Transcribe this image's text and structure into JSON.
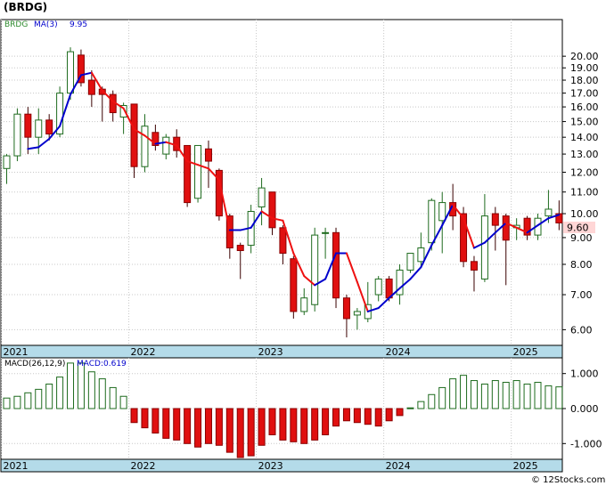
{
  "title": "(BRDG)",
  "footer": "© 12Stocks.com",
  "chart_data": [
    {
      "type": "candlestick",
      "ticker": "BRDG",
      "legend": {
        "ticker_label": "BRDG",
        "ma_label": "MA(3)",
        "ma_value": "9.95"
      },
      "last_price": "9.60",
      "y_scale": "log",
      "ylim": [
        5.6,
        23.5
      ],
      "y_ticks": [
        "20.00",
        "19.00",
        "18.00",
        "17.00",
        "16.00",
        "15.00",
        "14.00",
        "13.00",
        "12.00",
        "11.00",
        "10.00",
        "9.00",
        "8.00",
        "7.00",
        "6.00"
      ],
      "x_labels": [
        {
          "label": "2021",
          "month": 0
        },
        {
          "label": "2022",
          "month": 12
        },
        {
          "label": "2023",
          "month": 24
        },
        {
          "label": "2024",
          "month": 36
        },
        {
          "label": "2025",
          "month": 48
        }
      ],
      "candles": [
        [
          12.2,
          12.9,
          11.4,
          13.0
        ],
        [
          12.9,
          15.5,
          12.6,
          15.9
        ],
        [
          15.5,
          14.0,
          13.0,
          16.0
        ],
        [
          14.0,
          15.1,
          13.0,
          15.9
        ],
        [
          15.1,
          14.2,
          13.8,
          15.5
        ],
        [
          14.2,
          17.0,
          14.0,
          17.5
        ],
        [
          17.0,
          20.4,
          16.5,
          20.8
        ],
        [
          20.1,
          17.8,
          17.5,
          20.6
        ],
        [
          18.0,
          16.9,
          16.0,
          18.8
        ],
        [
          17.3,
          16.9,
          15.0,
          17.5
        ],
        [
          16.9,
          15.6,
          15.0,
          17.2
        ],
        [
          15.3,
          16.1,
          14.2,
          16.3
        ],
        [
          16.2,
          12.3,
          11.7,
          16.2
        ],
        [
          12.3,
          14.7,
          12.0,
          15.5
        ],
        [
          14.3,
          13.5,
          13.2,
          14.8
        ],
        [
          13.0,
          14.0,
          12.7,
          14.2
        ],
        [
          14.0,
          13.2,
          12.8,
          14.5
        ],
        [
          13.5,
          10.5,
          10.3,
          13.5
        ],
        [
          10.7,
          13.5,
          10.5,
          13.5
        ],
        [
          13.3,
          12.6,
          11.2,
          13.8
        ],
        [
          12.1,
          9.9,
          9.7,
          12.2
        ],
        [
          9.9,
          8.6,
          8.2,
          10.0
        ],
        [
          8.7,
          8.5,
          7.5,
          8.8
        ],
        [
          8.7,
          10.1,
          8.4,
          10.4
        ],
        [
          10.3,
          11.2,
          9.5,
          11.7
        ],
        [
          11.0,
          9.4,
          9.1,
          11.0
        ],
        [
          9.4,
          8.4,
          8.0,
          9.5
        ],
        [
          8.2,
          6.5,
          6.3,
          8.3
        ],
        [
          6.5,
          6.9,
          6.4,
          7.2
        ],
        [
          6.7,
          9.1,
          6.5,
          9.4
        ],
        [
          9.2,
          9.2,
          8.2,
          9.4
        ],
        [
          9.2,
          6.9,
          6.6,
          9.4
        ],
        [
          6.9,
          6.3,
          5.8,
          7.0
        ],
        [
          6.4,
          6.5,
          6.0,
          6.6
        ],
        [
          6.3,
          6.7,
          6.2,
          7.4
        ],
        [
          7.0,
          7.5,
          6.8,
          7.6
        ],
        [
          7.5,
          6.9,
          6.8,
          7.6
        ],
        [
          7.0,
          7.8,
          6.7,
          8.0
        ],
        [
          7.8,
          8.4,
          7.7,
          8.4
        ],
        [
          8.1,
          8.6,
          7.9,
          9.2
        ],
        [
          8.8,
          10.6,
          8.5,
          10.7
        ],
        [
          9.7,
          10.5,
          8.4,
          11.0
        ],
        [
          10.5,
          9.9,
          9.3,
          11.4
        ],
        [
          10.0,
          8.1,
          7.9,
          10.3
        ],
        [
          8.1,
          7.8,
          7.1,
          8.3
        ],
        [
          7.5,
          9.9,
          7.4,
          10.9
        ],
        [
          10.0,
          9.5,
          8.5,
          10.3
        ],
        [
          9.9,
          8.9,
          7.3,
          10.0
        ],
        [
          9.4,
          9.5,
          8.9,
          9.8
        ],
        [
          9.8,
          9.1,
          8.9,
          9.9
        ],
        [
          9.1,
          9.8,
          8.9,
          10.0
        ],
        [
          9.9,
          10.2,
          9.6,
          11.1
        ],
        [
          10.0,
          9.6,
          9.3,
          10.6
        ]
      ],
      "ma_series_name": "MA(3)",
      "ma": [
        null,
        null,
        13.3,
        13.4,
        13.9,
        14.7,
        16.9,
        18.4,
        18.6,
        17.2,
        16.4,
        15.9,
        14.5,
        14.1,
        13.6,
        13.7,
        13.5,
        12.6,
        12.4,
        12.2,
        11.6,
        9.3,
        9.3,
        9.4,
        10.1,
        9.8,
        9.7,
        8.4,
        7.6,
        7.3,
        7.5,
        8.4,
        8.4,
        7.4,
        6.5,
        6.6,
        6.9,
        7.2,
        7.5,
        7.9,
        8.7,
        9.5,
        10.4,
        9.8,
        8.6,
        8.8,
        9.2,
        9.6,
        9.4,
        9.2,
        9.5,
        9.8,
        9.95
      ]
    },
    {
      "type": "bar",
      "series_label": "MACD(26,12,9)",
      "value_label": "MACD:0.619",
      "ylim": [
        -1.45,
        1.45
      ],
      "y_ticks": [
        "1.000",
        "0.000",
        "-1.000"
      ],
      "x_labels": [
        {
          "label": "2021",
          "month": 0
        },
        {
          "label": "2022",
          "month": 12
        },
        {
          "label": "2023",
          "month": 24
        },
        {
          "label": "2024",
          "month": 36
        },
        {
          "label": "2025",
          "month": 48
        }
      ],
      "values": [
        0.3,
        0.35,
        0.45,
        0.55,
        0.7,
        0.9,
        1.3,
        1.3,
        1.05,
        0.85,
        0.6,
        0.35,
        -0.4,
        -0.55,
        -0.7,
        -0.85,
        -0.9,
        -1.0,
        -1.1,
        -1.0,
        -1.05,
        -1.25,
        -1.4,
        -1.35,
        -1.05,
        -0.75,
        -0.9,
        -0.95,
        -1.0,
        -0.9,
        -0.75,
        -0.5,
        -0.35,
        -0.4,
        -0.45,
        -0.5,
        -0.35,
        -0.2,
        0.02,
        0.2,
        0.4,
        0.6,
        0.85,
        0.95,
        0.8,
        0.7,
        0.8,
        0.75,
        0.8,
        0.7,
        0.75,
        0.65,
        0.62
      ]
    }
  ]
}
